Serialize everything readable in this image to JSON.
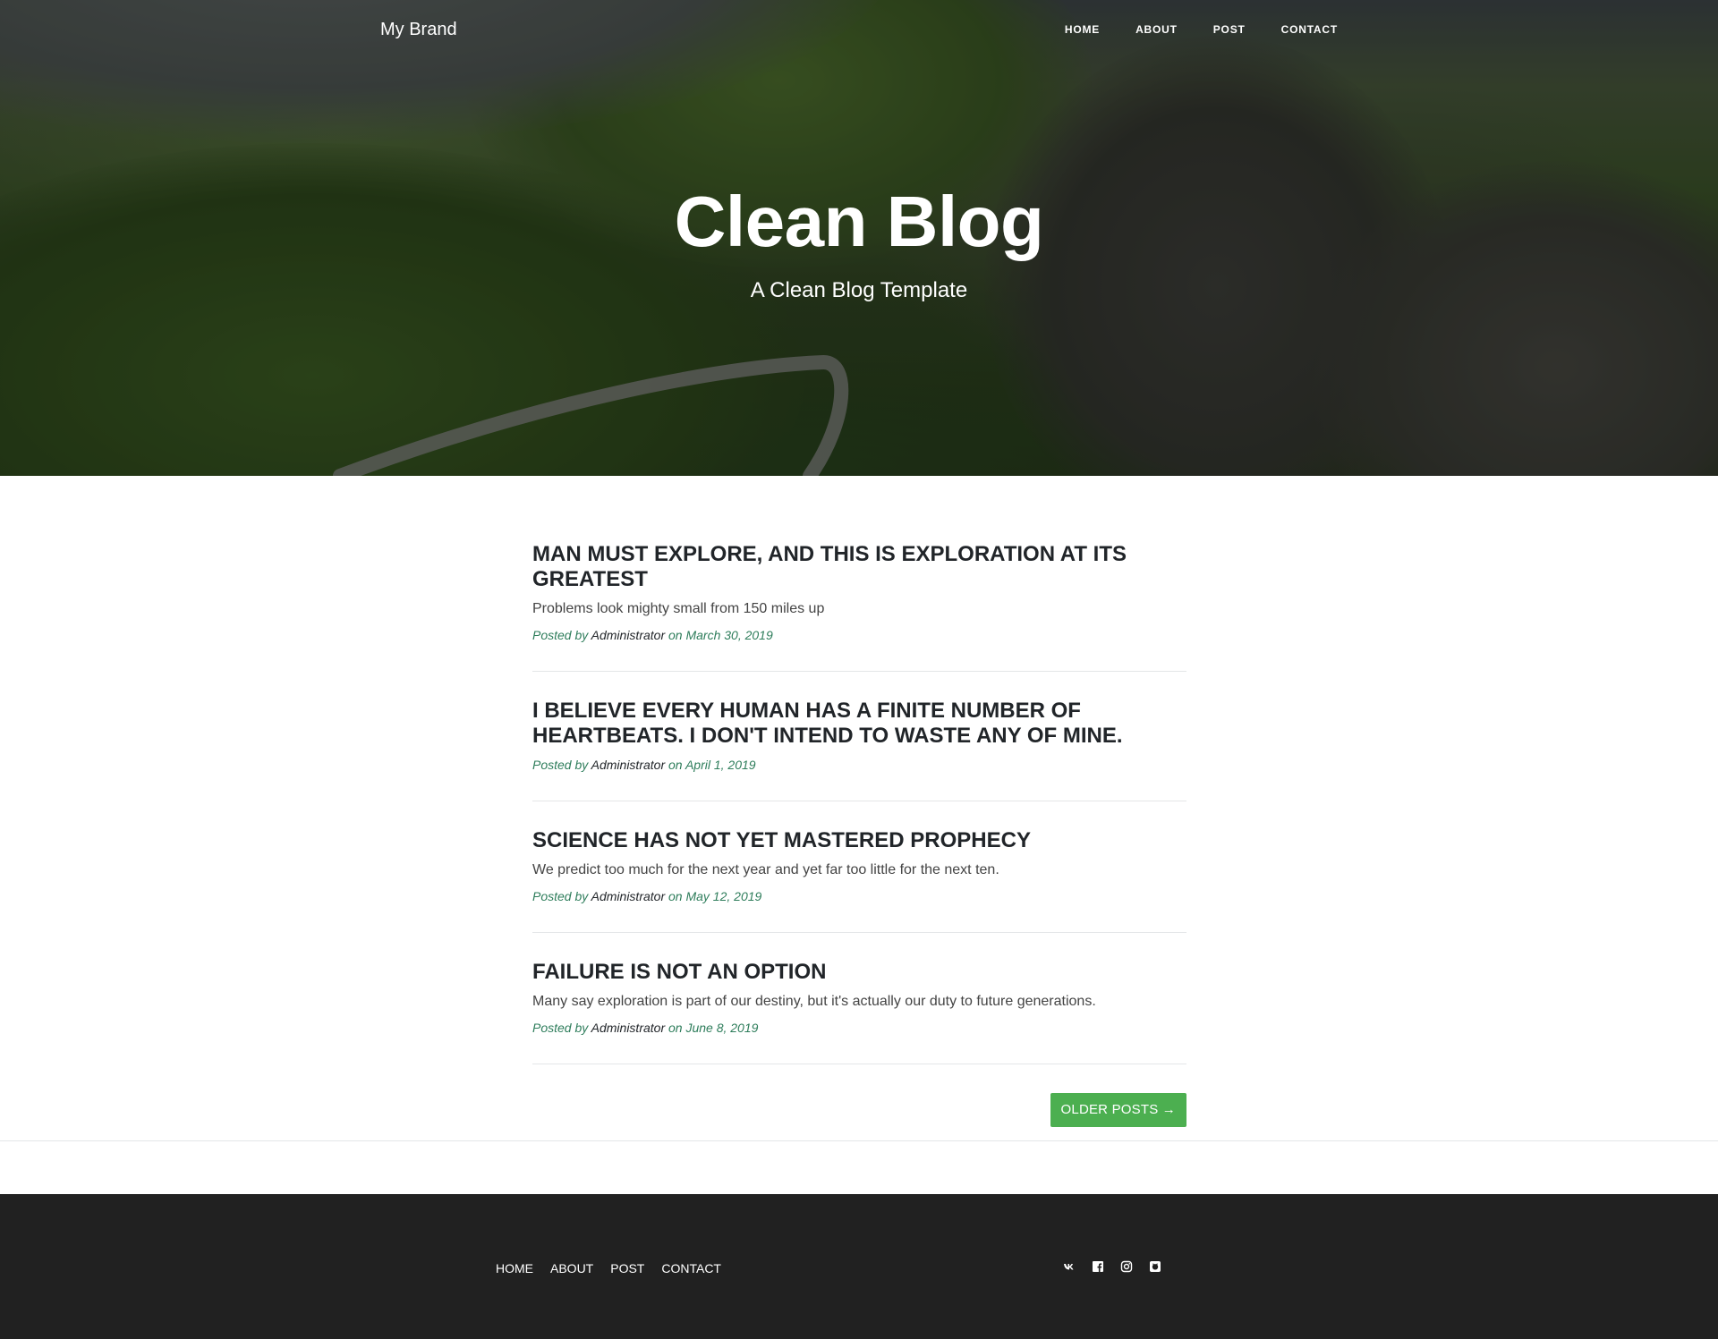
{
  "navbar": {
    "brand": "My Brand",
    "links": [
      "HOME",
      "ABOUT",
      "POST",
      "CONTACT"
    ]
  },
  "hero": {
    "title": "Clean Blog",
    "subtitle": "A Clean Blog Template"
  },
  "posts": [
    {
      "title": "MAN MUST EXPLORE, AND THIS IS EXPLORATION AT ITS GREATEST",
      "subtitle": "Problems look mighty small from 150 miles up",
      "meta_prefix": "Posted by",
      "author": "Administrator",
      "date": "on March 30, 2019"
    },
    {
      "title": "I BELIEVE EVERY HUMAN HAS A FINITE NUMBER OF HEARTBEATS. I DON'T INTEND TO WASTE ANY OF MINE.",
      "subtitle": "",
      "meta_prefix": "Posted by",
      "author": "Administrator",
      "date": "on April 1, 2019"
    },
    {
      "title": "SCIENCE HAS NOT YET MASTERED PROPHECY",
      "subtitle": "We predict too much for the next year and yet far too little for the next ten.",
      "meta_prefix": "Posted by",
      "author": "Administrator",
      "date": "on May 12, 2019"
    },
    {
      "title": "FAILURE IS NOT AN OPTION",
      "subtitle": "Many say exploration is part of our destiny, but it's actually our duty to future generations.",
      "meta_prefix": "Posted by",
      "author": "Administrator",
      "date": "on June 8, 2019"
    }
  ],
  "pager": {
    "older_label": "OLDER POSTS →"
  },
  "footer": {
    "links": [
      "HOME",
      "ABOUT",
      "POST",
      "CONTACT"
    ],
    "social_icons": [
      "vk-icon",
      "facebook-icon",
      "instagram-icon",
      "github-icon"
    ]
  },
  "colors": {
    "accent_green": "#4caf50",
    "meta_green": "#2e7d5b",
    "footer_bg": "#212121",
    "title_text": "#212529"
  }
}
